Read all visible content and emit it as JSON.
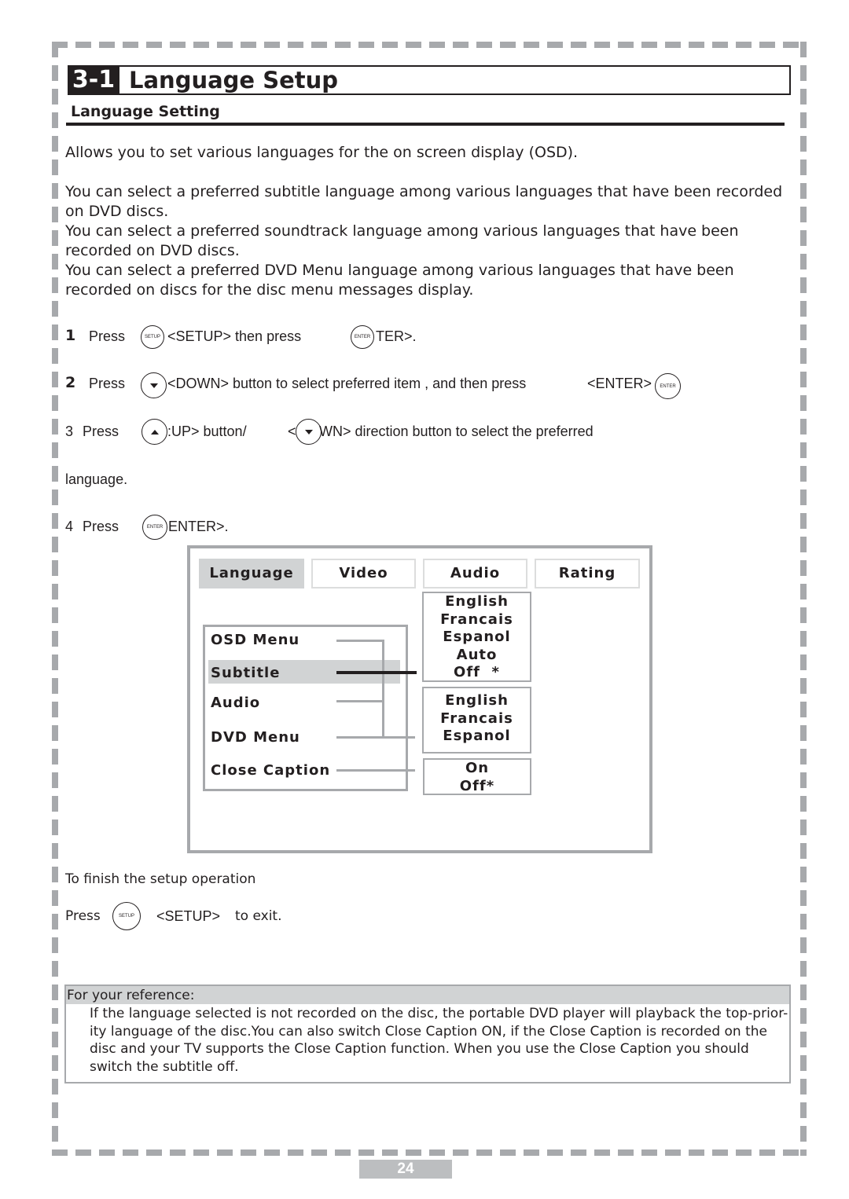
{
  "header": {
    "section_number": "3-1",
    "section_title": "Language Setup",
    "subsection_title": "Language Setting"
  },
  "intro": {
    "p1": "Allows you to set various languages for the on screen display (OSD).",
    "p2": "You can select a preferred subtitle language among various languages that have been recorded on DVD discs.",
    "p3": "You can select a preferred soundtrack language among various languages that have been recorded on DVD discs.",
    "p4": "You can select a preferred DVD Menu language among various languages that have been recorded on discs for the disc menu messages display."
  },
  "icons": {
    "setup": "SETUP",
    "enter": "ENTER"
  },
  "steps": [
    {
      "num": "1",
      "press": "Press",
      "text_a": "<SETUP> then press",
      "text_b": "TER>."
    },
    {
      "num": "2",
      "press": "Press",
      "text_a": "<DOWN> button to select  preferred item , and then press",
      "text_b": "<ENTER>"
    },
    {
      "num": "3",
      "press": "Press",
      "text_a": ":UP> button/",
      "text_b": "<",
      "text_c": "WN> direction button to select the preferred",
      "text_d": "language."
    },
    {
      "num": "4",
      "press": "Press",
      "text_a": "ENTER>."
    }
  ],
  "osd": {
    "tabs": [
      {
        "label": "Language",
        "active": true
      },
      {
        "label": "Video",
        "active": false
      },
      {
        "label": "Audio",
        "active": false
      },
      {
        "label": "Rating",
        "active": false
      }
    ],
    "menu_items": [
      "OSD Menu",
      "Subtitle",
      "Audio",
      "DVD Menu",
      "Close Caption"
    ],
    "selected_item": "Subtitle",
    "subtitle_options": [
      "English",
      "Francais",
      "Espanol",
      "Auto",
      "Off  *"
    ],
    "language_options": [
      "English",
      "Francais",
      "Espanol"
    ],
    "caption_options": [
      "On",
      "Off*"
    ]
  },
  "finish": {
    "heading": "To finish the setup operation",
    "press": "Press",
    "key": "<SETUP>",
    "tail": "to exit."
  },
  "reference": {
    "heading": "For your reference:",
    "body": "If the language selected is not recorded on the disc, the portable DVD player will playback the top-prior-ity language of the disc.You can also switch Close Caption ON, if the Close Caption is recorded on the disc and your TV supports the Close Caption function. When you use the Close Caption you should switch the subtitle off."
  },
  "page_number": "24"
}
